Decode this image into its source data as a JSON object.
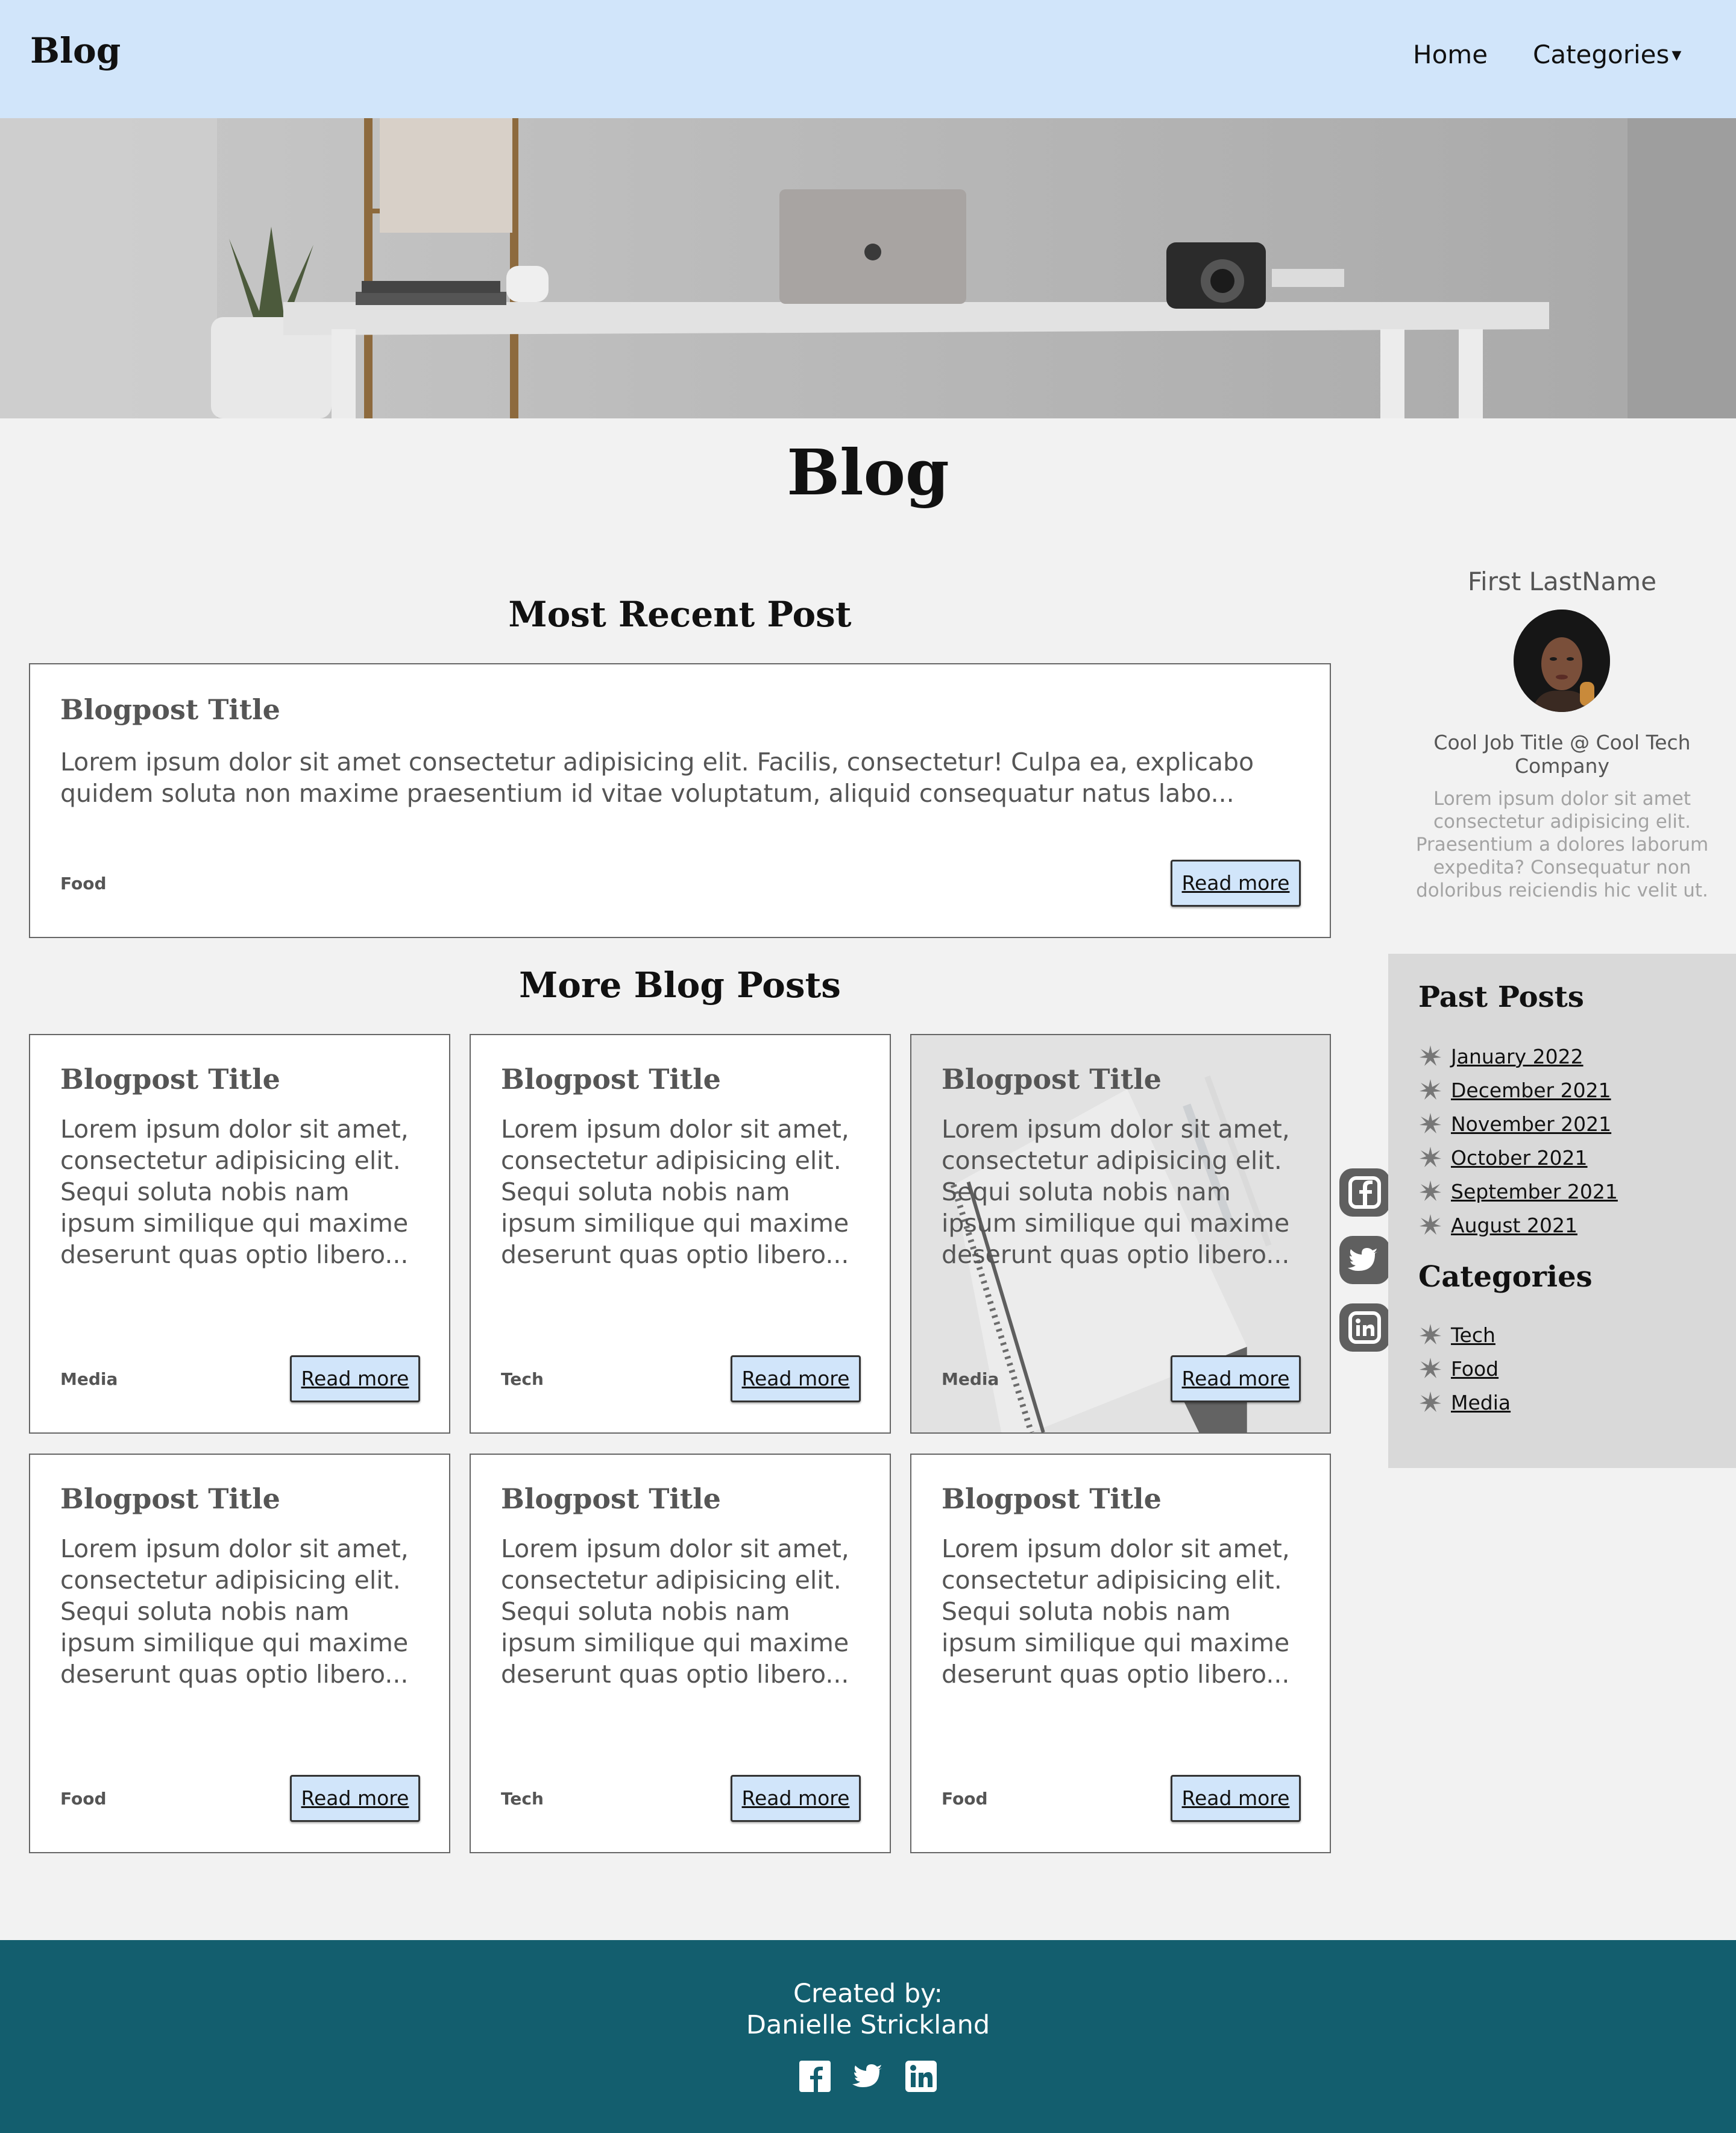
{
  "header": {
    "brand": "Blog",
    "nav": {
      "home": "Home",
      "categories": "Categories",
      "caret": "▾"
    }
  },
  "page": {
    "title": "Blog"
  },
  "recent": {
    "heading": "Most Recent Post",
    "post": {
      "title": "Blogpost Title",
      "excerpt": "Lorem ipsum dolor sit amet consectetur adipisicing elit. Facilis, consectetur! Culpa ea, explicabo quidem soluta non maxime praesentium id vitae voluptatum, aliquid consequatur natus labo...",
      "tag": "Food",
      "button": "Read more"
    }
  },
  "more": {
    "heading": "More Blog Posts",
    "posts": [
      {
        "title": "Blogpost Title",
        "excerpt": "Lorem ipsum dolor sit amet, consectetur adipisicing elit. Sequi soluta nobis nam ipsum similique qui maxime deserunt quas optio libero...",
        "tag": "Media",
        "button": "Read more"
      },
      {
        "title": "Blogpost Title",
        "excerpt": "Lorem ipsum dolor sit amet, consectetur adipisicing elit. Sequi soluta nobis nam ipsum similique qui maxime deserunt quas optio libero...",
        "tag": "Tech",
        "button": "Read more"
      },
      {
        "title": "Blogpost Title",
        "excerpt": "Lorem ipsum dolor sit amet, consectetur adipisicing elit. Sequi soluta nobis nam ipsum similique qui maxime deserunt quas optio libero...",
        "tag": "Media",
        "button": "Read more"
      },
      {
        "title": "Blogpost Title",
        "excerpt": "Lorem ipsum dolor sit amet, consectetur adipisicing elit. Sequi soluta nobis nam ipsum similique qui maxime deserunt quas optio libero...",
        "tag": "Food",
        "button": "Read more"
      },
      {
        "title": "Blogpost Title",
        "excerpt": "Lorem ipsum dolor sit amet, consectetur adipisicing elit. Sequi soluta nobis nam ipsum similique qui maxime deserunt quas optio libero...",
        "tag": "Tech",
        "button": "Read more"
      },
      {
        "title": "Blogpost Title",
        "excerpt": "Lorem ipsum dolor sit amet, consectetur adipisicing elit. Sequi soluta nobis nam ipsum similique qui maxime deserunt quas optio libero...",
        "tag": "Food",
        "button": "Read more"
      }
    ]
  },
  "social": {
    "icons": [
      "facebook-icon",
      "twitter-icon",
      "linkedin-icon"
    ]
  },
  "profile": {
    "name": "First LastName",
    "job": "Cool Job Title @ Cool Tech Company",
    "bio": "Lorem ipsum dolor sit amet consectetur adipisicing elit. Praesentium a dolores laborum expedita? Consequatur non doloribus reiciendis hic velit ut."
  },
  "sidebar": {
    "past_heading": "Past Posts",
    "past": [
      "January 2022",
      "December 2021",
      "November 2021",
      "October 2021",
      "September 2021",
      "August 2021"
    ],
    "cat_heading": "Categories",
    "categories": [
      "Tech",
      "Food",
      "Media"
    ]
  },
  "footer": {
    "created": "Created by:",
    "author": "Danielle Strickland"
  },
  "colors": {
    "header_bg": "#d1e5fa",
    "button_bg": "#d1e5fa",
    "footer_bg": "#135e6e",
    "sidebar_bg": "#d9d9d9",
    "page_bg": "#f2f2f2"
  }
}
